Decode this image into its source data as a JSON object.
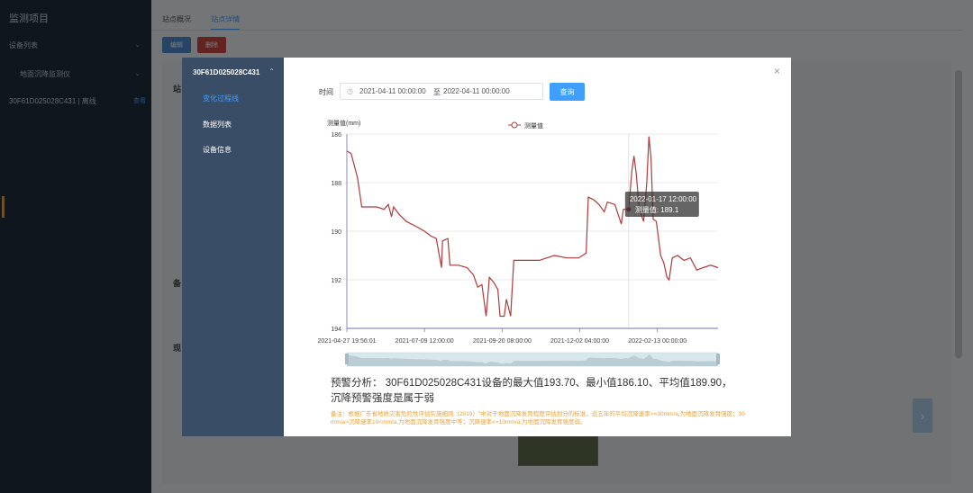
{
  "app": {
    "title": "监测项目",
    "menu": [
      {
        "label": "设备列表"
      },
      {
        "label": "地面沉降监测仪"
      },
      {
        "label": "30F61D025028C431 | 离线",
        "link": "查看"
      }
    ]
  },
  "background": {
    "tabs": [
      "站点概况",
      "站点详情"
    ],
    "buttons": [
      "编辑",
      "删除"
    ],
    "labels": [
      "站",
      "备",
      "现"
    ]
  },
  "modal": {
    "device_id": "30F61D025028C431",
    "menu": [
      "变化过程线",
      "数据列表",
      "设备信息"
    ],
    "time_label": "时间",
    "date_start": "2021-04-11 00:00:00",
    "date_sep": "至",
    "date_end": "2022-04-11 00:00:00",
    "query_label": "查询",
    "analysis": "预警分析： 30F61D025028C431设备的最大值193.70、最小值186.10、平均值189.90， 沉降预警强度是属于弱",
    "note": "备注：根据广东省地质灾害危险性评估实施细则（2019）\"中对于地面沉降发育程度评估划分的标准，近五年的平均沉降速率>=30mm/a,为地面沉降发育强度；30 mm/a>沉降速率10<mm/a,为地面沉降发育强度中等；沉降速率<=10mm/a,为地面沉降发育强度弱。"
  },
  "chart_data": {
    "type": "line",
    "ylabel": "测量值(mm)",
    "legend": "测量值",
    "y_inverted": true,
    "ylim": [
      186,
      194
    ],
    "yticks": [
      186,
      188,
      190,
      192,
      194
    ],
    "xticks": [
      "2021-04-27 19:56:01",
      "2021-07-09 12:00:00",
      "2021-09-20 08:00:00",
      "2021-12-02 04:00:00",
      "2022-02-13 00:00:00"
    ],
    "x_range": [
      "2021-04-27",
      "2022-04-11"
    ],
    "color": "#b03a3a",
    "tooltip": {
      "title": "2022-01-17 12:00:00",
      "text": "测量值: 189.1",
      "x": "2022-01-17",
      "y": 189.1
    },
    "points": [
      [
        "2021-04-27",
        186.7
      ],
      [
        "2021-05-01",
        186.8
      ],
      [
        "2021-05-04",
        187.3
      ],
      [
        "2021-05-07",
        187.8
      ],
      [
        "2021-05-09",
        188.4
      ],
      [
        "2021-05-11",
        189.0
      ],
      [
        "2021-05-25",
        189.0
      ],
      [
        "2021-06-01",
        189.1
      ],
      [
        "2021-06-05",
        188.9
      ],
      [
        "2021-06-08",
        189.4
      ],
      [
        "2021-06-10",
        189.0
      ],
      [
        "2021-06-15",
        189.3
      ],
      [
        "2021-06-22",
        189.6
      ],
      [
        "2021-07-01",
        189.8
      ],
      [
        "2021-07-09",
        190.0
      ],
      [
        "2021-07-15",
        190.2
      ],
      [
        "2021-07-20",
        190.3
      ],
      [
        "2021-07-25",
        191.5
      ],
      [
        "2021-07-26",
        190.4
      ],
      [
        "2021-07-31",
        190.3
      ],
      [
        "2021-08-02",
        191.4
      ],
      [
        "2021-08-03",
        191.4
      ],
      [
        "2021-08-10",
        191.4
      ],
      [
        "2021-08-18",
        191.5
      ],
      [
        "2021-08-24",
        191.8
      ],
      [
        "2021-08-28",
        192.3
      ],
      [
        "2021-09-01",
        192.2
      ],
      [
        "2021-09-05",
        193.5
      ],
      [
        "2021-09-08",
        191.9
      ],
      [
        "2021-09-12",
        192.1
      ],
      [
        "2021-09-16",
        192.4
      ],
      [
        "2021-09-18",
        193.5
      ],
      [
        "2021-09-22",
        193.5
      ],
      [
        "2021-09-24",
        192.8
      ],
      [
        "2021-09-28",
        193.5
      ],
      [
        "2021-10-01",
        191.2
      ],
      [
        "2021-10-10",
        191.2
      ],
      [
        "2021-10-18",
        191.2
      ],
      [
        "2021-10-25",
        191.2
      ],
      [
        "2021-11-01",
        191.1
      ],
      [
        "2021-11-08",
        191.0
      ],
      [
        "2021-11-20",
        191.1
      ],
      [
        "2021-12-01",
        191.1
      ],
      [
        "2021-12-08",
        190.9
      ],
      [
        "2021-12-10",
        188.6
      ],
      [
        "2021-12-15",
        188.7
      ],
      [
        "2021-12-20",
        188.9
      ],
      [
        "2021-12-25",
        189.2
      ],
      [
        "2021-12-28",
        188.8
      ],
      [
        "2022-01-04",
        188.9
      ],
      [
        "2022-01-10",
        189.7
      ],
      [
        "2022-01-12",
        189.1
      ],
      [
        "2022-01-17",
        189.1
      ],
      [
        "2022-01-20",
        187.5
      ],
      [
        "2022-01-22",
        186.9
      ],
      [
        "2022-01-24",
        187.6
      ],
      [
        "2022-01-27",
        189.1
      ],
      [
        "2022-01-31",
        189.6
      ],
      [
        "2022-02-03",
        188.0
      ],
      [
        "2022-02-05",
        186.1
      ],
      [
        "2022-02-07",
        187.0
      ],
      [
        "2022-02-09",
        189.5
      ],
      [
        "2022-02-12",
        189.6
      ],
      [
        "2022-02-16",
        191.0
      ],
      [
        "2022-02-19",
        191.3
      ],
      [
        "2022-02-22",
        191.9
      ],
      [
        "2022-02-24",
        192.0
      ],
      [
        "2022-02-27",
        191.1
      ],
      [
        "2022-03-04",
        191.0
      ],
      [
        "2022-03-10",
        191.2
      ],
      [
        "2022-03-16",
        191.1
      ],
      [
        "2022-03-22",
        191.6
      ],
      [
        "2022-03-28",
        191.5
      ],
      [
        "2022-04-04",
        191.4
      ],
      [
        "2022-04-11",
        191.5
      ]
    ]
  }
}
